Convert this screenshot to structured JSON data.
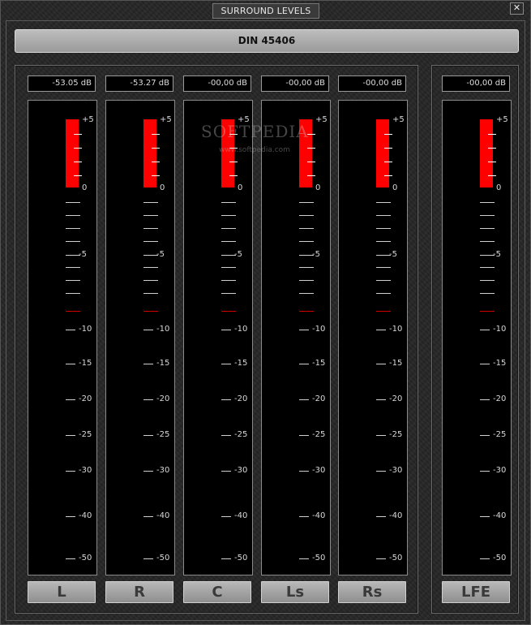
{
  "window": {
    "title": "SURROUND LEVELS",
    "close_label": "✕"
  },
  "standard": {
    "label": "DIN 45406"
  },
  "watermark": {
    "text": "SOFTPEDIA",
    "sub": "www.softpedia.com"
  },
  "scale": {
    "labels": [
      "+5",
      "0",
      "-5",
      "-10",
      "-15",
      "-20",
      "-25",
      "-30",
      "-40",
      "-50"
    ]
  },
  "channels": [
    {
      "name": "L",
      "readout": "-53.05 dB",
      "peak_db": 5
    },
    {
      "name": "R",
      "readout": "-53.27 dB",
      "peak_db": 5
    },
    {
      "name": "C",
      "readout": "-00,00 dB",
      "peak_db": 5
    },
    {
      "name": "Ls",
      "readout": "-00,00 dB",
      "peak_db": 5
    },
    {
      "name": "Rs",
      "readout": "-00,00 dB",
      "peak_db": 5
    },
    {
      "name": "LFE",
      "readout": "-00,00 dB",
      "peak_db": 5
    }
  ],
  "colors": {
    "peak": "#ff0000",
    "reference_mark": "#d00000"
  }
}
